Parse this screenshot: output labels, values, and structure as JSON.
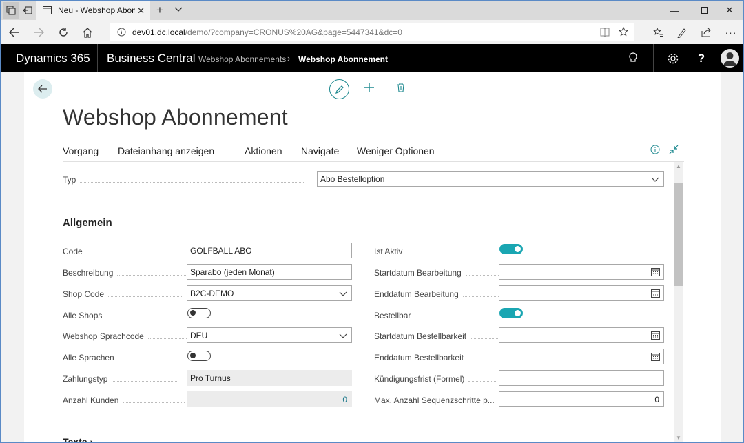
{
  "browser": {
    "tab_title": "Neu - Webshop Abonne",
    "url_host": "dev01.dc.local",
    "url_path": "/demo/?company=CRONUS%20AG&page=5447341&dc=0"
  },
  "header": {
    "product": "Dynamics 365",
    "app": "Business Central",
    "breadcrumb": [
      "Webshop Abonnements",
      "Webshop Abonnement"
    ]
  },
  "page": {
    "title": "Webshop Abonnement",
    "actions": [
      "Vorgang",
      "Dateianhang anzeigen",
      "Aktionen",
      "Navigate",
      "Weniger Optionen"
    ]
  },
  "typ": {
    "label": "Typ",
    "value": "Abo Bestelloption"
  },
  "section": {
    "title": "Allgemein",
    "next": "Texte"
  },
  "left": {
    "code": {
      "label": "Code",
      "value": "GOLFBALL ABO"
    },
    "beschreibung": {
      "label": "Beschreibung",
      "value": "Sparabo (jeden Monat)"
    },
    "shop_code": {
      "label": "Shop Code",
      "value": "B2C-DEMO"
    },
    "alle_shops": {
      "label": "Alle Shops",
      "value": false
    },
    "sprachcode": {
      "label": "Webshop Sprachcode",
      "value": "DEU"
    },
    "alle_sprachen": {
      "label": "Alle Sprachen",
      "value": false
    },
    "zahlungstyp": {
      "label": "Zahlungstyp",
      "value": "Pro Turnus"
    },
    "anzahl_kunden": {
      "label": "Anzahl Kunden",
      "value": "0"
    }
  },
  "right": {
    "ist_aktiv": {
      "label": "Ist Aktiv",
      "value": true
    },
    "start_bearb": {
      "label": "Startdatum Bearbeitung",
      "value": ""
    },
    "end_bearb": {
      "label": "Enddatum Bearbeitung",
      "value": ""
    },
    "bestellbar": {
      "label": "Bestellbar",
      "value": true
    },
    "start_best": {
      "label": "Startdatum Bestellbarkeit",
      "value": ""
    },
    "end_best": {
      "label": "Enddatum Bestellbarkeit",
      "value": ""
    },
    "kuendigung": {
      "label": "Kündigungsfrist (Formel)",
      "value": ""
    },
    "max_seq": {
      "label": "Max. Anzahl Sequenzschritte p...",
      "value": "0"
    }
  },
  "colors": {
    "accent": "#1aa6b2",
    "header_bg": "#000000"
  }
}
